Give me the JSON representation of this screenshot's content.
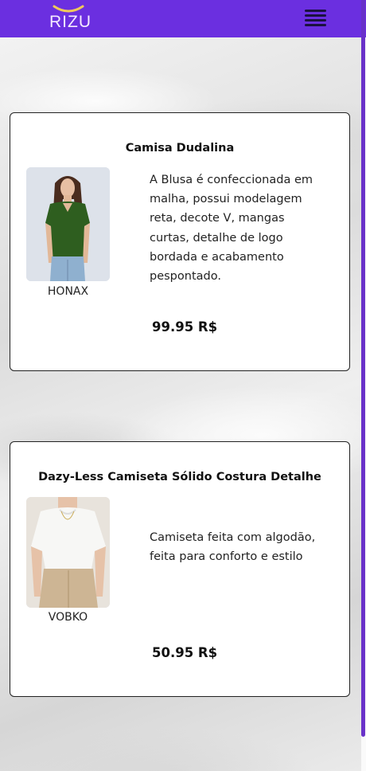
{
  "header": {
    "logo_text": "RIZU",
    "menu_icon": "hamburger-menu-icon",
    "brand_color": "#6b2fe0"
  },
  "products": [
    {
      "title": "Camisa Dudalina",
      "brand": "HONAX",
      "description": "A Blusa é confeccionada em malha, possui modelagem reta, decote V, mangas curtas, detalhe de logo bordada e acabamento pespontado.",
      "price": "99.95 R$"
    },
    {
      "title": "Dazy-Less Camiseta Sólido Costura Detalhe",
      "brand": "VOBKO",
      "description": "Camiseta feita com algodão, feita para conforto e estilo",
      "price": "50.95 R$"
    }
  ]
}
